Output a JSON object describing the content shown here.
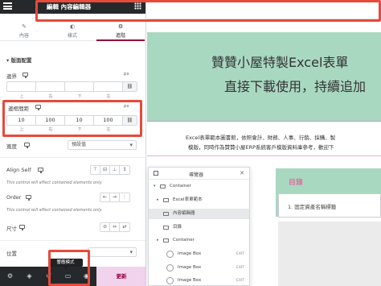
{
  "header": {
    "title": "編輯 內容編輯器"
  },
  "tabs": [
    {
      "icon": "✎",
      "label": "內容"
    },
    {
      "icon": "◐",
      "label": "樣式"
    },
    {
      "icon": "⚙",
      "label": "進階"
    }
  ],
  "layout_section": {
    "title": "▾ 版面配置"
  },
  "margin": {
    "label": "邊界",
    "unit": "px",
    "values": [
      "",
      "",
      "",
      ""
    ],
    "sub_labels": [
      "上",
      "右",
      "下",
      "左"
    ]
  },
  "padding": {
    "label": "邊框間距",
    "unit": "px",
    "values": [
      "10",
      "100",
      "10",
      "100"
    ],
    "sub_labels": [
      "上",
      "右",
      "下",
      "左"
    ]
  },
  "width": {
    "label": "寬度",
    "value": "預設值"
  },
  "align_self": {
    "label": "Align Self",
    "hint": "This control will affect contained elements only."
  },
  "order": {
    "label": "Order",
    "hint": "This control will affect contained elements only."
  },
  "size": {
    "label": "尺寸"
  },
  "position": {
    "label": "位置"
  },
  "bottom": {
    "tooltip": "響應模式",
    "update_label": "更新"
  },
  "canvas": {
    "hero_line1": "贊贊小屋特製Excel表單",
    "hero_line2": "直接下載使用，持續追加",
    "intro_line1": "Excel表單範本圖書館，依照會計、財務、人事、行銷、採購、製",
    "intro_line2": "模版，同時作為贊贊小屋ERP系統客戶模版資料庫參考，歡迎下",
    "toc_title": "目錄",
    "toc_item": "1.  固定資產名稱標籤"
  },
  "navigator": {
    "title": "導覽器",
    "rows": [
      {
        "label": "Container",
        "indent": 0,
        "caret": "▾",
        "exit": ""
      },
      {
        "label": "Excel表單範本",
        "indent": 1,
        "caret": "▸",
        "exit": ""
      },
      {
        "label": "內容編輯器",
        "indent": 1,
        "caret": "",
        "exit": ""
      },
      {
        "label": "目錄",
        "indent": 1,
        "caret": "",
        "exit": ""
      },
      {
        "label": "Container",
        "indent": 1,
        "caret": "▸",
        "exit": ""
      },
      {
        "label": "Image Box",
        "indent": 1,
        "caret": "",
        "exit": "EXIT"
      },
      {
        "label": "Image Box",
        "indent": 1,
        "caret": "",
        "exit": "EXIT"
      },
      {
        "label": "Image Box",
        "indent": 1,
        "caret": "",
        "exit": "EXIT"
      }
    ]
  },
  "colors": {
    "accent": "#93003c",
    "highlight_box": "#e64a3b",
    "hero_bg": "#a9d8c1",
    "toc_title": "#e64a8c"
  }
}
